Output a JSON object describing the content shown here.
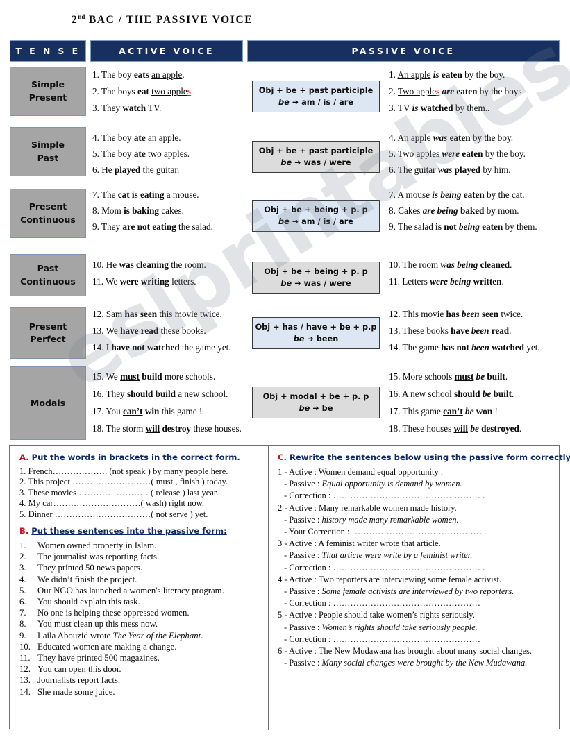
{
  "title": {
    "sup": "nd",
    "pre": "2",
    "rest": " BAC / THE PASSIVE VOICE"
  },
  "headers": {
    "tense": "T E N S E",
    "active": "ACTIVE VOICE",
    "passive": "PASSIVE VOICE"
  },
  "rows": [
    {
      "tense_line1": "Simple",
      "tense_line2": "Present",
      "formula_line1": "Obj +  be  +  past participle",
      "formula_be": "be",
      "formula_value": "am / is / are",
      "formula_style": "blue",
      "active": [
        "1. The boy  <b>eats</b> <u>an apple</u>.",
        "2. The boys  <b>eat</b> <u>two apple</u><span class=\"red\"><u>s</u></span>.",
        "3. They <b>watch</b>  <u>TV</u>."
      ],
      "passive": [
        "1. <u>An apple</u> <i>is</i> <b>eaten</b> by the boy.",
        "2. <u>Two apple</u><span class=\"red\"><u>s</u></span> <i>are</i> <b>eaten</b> by the boys",
        "3. <u>TV</u> <i>is</i> <b>watched</b> by them.."
      ]
    },
    {
      "tense_line1": "Simple",
      "tense_line2": "Past",
      "formula_line1": "Obj +  be  +  past participle",
      "formula_be": "be",
      "formula_value": "was / were",
      "formula_style": "grey",
      "active": [
        "4. The boy  <b>ate</b> an apple.",
        "5. The boy <b>ate</b> two apples.",
        "6. He  <b>played</b> the guitar."
      ],
      "passive": [
        "4. An apple <i>was</i> <b>eaten</b> by the boy.",
        "5. Two apples <i>were</i> <b>eaten</b> by the boy.",
        "6. The guitar <i>was</i> <b>played</b> by him."
      ]
    },
    {
      "tense_line1": "Present",
      "tense_line2": "Continuous",
      "formula_line1": "Obj +  be +  being  +  p. p",
      "formula_be": "be",
      "formula_value": "am / is / are",
      "formula_style": "blue",
      "active": [
        "7. The <b>cat is eating</b> a mouse.",
        "8. Mom  <b>is baking</b> cakes.",
        "9. They  <b>are not eating</b> the salad."
      ],
      "passive": [
        "7. A mouse <i>is being</i>  <b>eaten</b> by the cat.",
        "8. Cakes <i>are being</i> <b>baked</b> by mom.",
        "9. The salad  <b>is not</b> <i>being</i> <b>eaten</b> by them."
      ]
    },
    {
      "tense_line1": "Past",
      "tense_line2": "Continuous",
      "formula_line1": "Obj +  be +  being  +  p. p",
      "formula_be": "be",
      "formula_value": "was / were",
      "formula_style": "grey",
      "active": [
        "10. He  <b>was cleaning</b> the room.",
        "11. We <b>were writing</b>  letters."
      ],
      "passive": [
        "10. The room <i>was being</i> <b>cleaned</b>.",
        "11. Letters <i>were being</i> <b>written</b>."
      ]
    },
    {
      "tense_line1": "Present",
      "tense_line2": "Perfect",
      "formula_line1": "Obj +  has / have +  be  +  p.p",
      "formula_be": "be",
      "formula_value": "been",
      "formula_style": "blue",
      "active": [
        "12. Sam <b>has seen</b> this  movie twice.",
        "13. We  <b>have read</b> these books.",
        "14. I <b>have not watched</b> the game yet."
      ],
      "passive": [
        "12. This movie <b>has</b> <i>been</i> <b>seen</b> twice.",
        "13. These books <b>have</b> <i>been</i> <b>read</b>.",
        "14. The game <b>has not</b> <i>been</i> <b>watched</b> yet."
      ]
    },
    {
      "tense_line1": "Modals",
      "tense_line2": "",
      "formula_line1": "Obj +  modal  +  be  +  p. p",
      "formula_be": "be",
      "formula_value": "be",
      "formula_style": "grey",
      "active": [
        "15. We  <b><u>must</u> build</b> more schools.",
        "16. They <b><u>should</u> build</b>  a new school.",
        "17. You  <b><u>can&rsquo;t</u> win</b> this game !",
        "18. The storm <b><u>will</u> destroy</b> these houses."
      ],
      "passive": [
        "15. More schools <b><u>must</u></b>  <i>be</i> <b>built</b>.",
        "16. A new school <b><u>should</u></b>  <i>be</i> <b>built</b>.",
        "17. This game <b><u>can&rsquo;t</u></b>  <i>be</i> <b>won</b> !",
        "18. These  houses <b><u>will</u></b>  <i>be</i> <b>destroyed</b>."
      ]
    }
  ],
  "exercises": {
    "a": {
      "letter": "A.",
      "heading": "Put the words in brackets  in the correct form.",
      "items": [
        "1. French&hellip;&hellip;&hellip;&hellip;&hellip;&hellip;. (not  speak ) by many people here.",
        "2. This project &hellip;&hellip;&hellip;&hellip;&hellip;&hellip;&hellip;&hellip;&hellip;( must , finish ) today.",
        "3. These movies &hellip;&hellip;&hellip;&hellip;&hellip;&hellip;&hellip;&hellip; ( release ) last year.",
        "4. My car&hellip;&hellip;&hellip;&hellip;&hellip;&hellip;&hellip;&hellip;&hellip;&hellip;( wash) right now.",
        "5. Dinner  &hellip;&hellip;&hellip;&hellip;&hellip;&hellip;&hellip;&hellip;&hellip;&hellip;&hellip;( not serve ) yet."
      ]
    },
    "b": {
      "letter": "B.",
      "heading": "Put these sentences into the passive form:",
      "items": [
        {
          "idx": "1.",
          "text": "Women owned property in Islam."
        },
        {
          "idx": "2.",
          "text": "The journalist was reporting facts."
        },
        {
          "idx": "3.",
          "text": "They printed  50 news papers."
        },
        {
          "idx": "4.",
          "text": "We didn&rsquo;t finish the project."
        },
        {
          "idx": "5.",
          "text": "Our NGO  has launched a women's literacy program."
        },
        {
          "idx": "6.",
          "text": "You should explain this task."
        },
        {
          "idx": "7.",
          "text": "No one is helping these oppressed women."
        },
        {
          "idx": "8.",
          "text": "You must clean up this mess now."
        },
        {
          "idx": "9.",
          "text": "Laila Abouzid  wrote  <i>The Year of the Elephant</i>."
        },
        {
          "idx": "10.",
          "text": "Educated women are making a change."
        },
        {
          "idx": "11.",
          "text": "They have printed 500 magazines."
        },
        {
          "idx": "12.",
          "text": "You  can  open this door."
        },
        {
          "idx": "13.",
          "text": "Journalists report facts."
        },
        {
          "idx": "14.",
          "text": "She made some juice."
        }
      ]
    },
    "c": {
      "letter": "C.",
      "heading": "Rewrite the sentences below using the passive form correctly.",
      "items": [
        {
          "num": "1 -",
          "active": "Active  :  Women demand equal opportunity .",
          "passive": "Passive :  <i>Equal opportunity  is  demand  by women.</i>",
          "correction": "- Correction  : &hellip;&hellip;&hellip;&hellip;&hellip;&hellip;&hellip;&hellip;&hellip;&hellip;&hellip;&hellip;&hellip;&hellip;&hellip;&hellip;&hellip; ."
        },
        {
          "num": "2 -",
          "active": "Active  :  Many remarkable women made history.",
          "passive": "Passive :  <i>history  made  many remarkable women.</i>",
          "correction": "- Your Correction  : &hellip;&hellip;&hellip;&hellip;&hellip;&hellip;&hellip;&hellip;&hellip;&hellip;&hellip;&hellip;&hellip;&hellip;&hellip; ."
        },
        {
          "num": "3 -",
          "active": "Active  :  A feminist writer  wrote that article.",
          "passive": "Passive :  <i>That  article were write by a feminist writer.</i>",
          "correction": "- Correction  : &hellip;&hellip;&hellip;&hellip;&hellip;&hellip;&hellip;&hellip;&hellip;&hellip;&hellip;&hellip;&hellip;&hellip;&hellip;&hellip;&hellip; ."
        },
        {
          "num": "4 -",
          "active": "Active  :  Two reporters are interviewing  some female activist.",
          "passive": "Passive :  <i>Some female activists are interviewed by two reporters.</i>",
          "correction": "- Correction  : &hellip;&hellip;&hellip;&hellip;&hellip;&hellip;&hellip;&hellip;&hellip;&hellip;&hellip;&hellip;&hellip;&hellip;&hellip;&hellip;&hellip;"
        },
        {
          "num": "5 -",
          "active": "Active  :  People should  take women&rsquo;s rights seriously.",
          "passive": "Passive :  <i>Women&rsquo;s rights  should take  seriously people.</i>",
          "correction": "- Correction  : &hellip;&hellip;&hellip;&hellip;&hellip;&hellip;&hellip;&hellip;&hellip;&hellip;&hellip;&hellip;&hellip;&hellip;&hellip;&hellip;&hellip;"
        },
        {
          "num": "6 -",
          "active": "Active  : The New Mudawana has brought about  many social changes.",
          "passive": "Passive :  <i>Many social changes  were brought  by the New Mudawana.</i>",
          "correction": ""
        }
      ]
    }
  },
  "watermark": {
    "text": "eslprintables.com"
  }
}
